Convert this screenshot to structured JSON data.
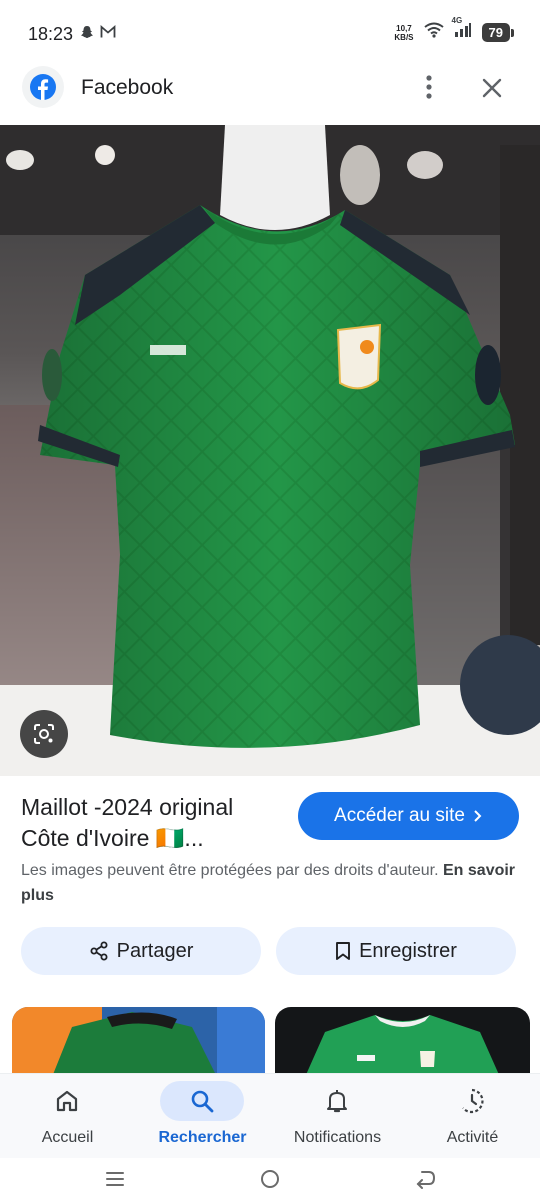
{
  "status": {
    "time": "18:23",
    "net_speed_value": "10,7",
    "net_speed_unit": "KB/S",
    "network": "4G",
    "battery": "79"
  },
  "header": {
    "title": "Facebook"
  },
  "result": {
    "title_line1": "Maillot -2024 original",
    "title_line2": "Côte d'Ivoire 🇨🇮...",
    "visit_label": "Accéder au site",
    "copyright_text": "Les images peuvent être protégées par des droits d'auteur.",
    "learn_more": "En savoir plus"
  },
  "actions": {
    "share_label": "Partager",
    "save_label": "Enregistrer"
  },
  "bottom_nav": {
    "items": [
      {
        "label": "Accueil",
        "icon": "home-icon"
      },
      {
        "label": "Rechercher",
        "icon": "search-icon",
        "active": true
      },
      {
        "label": "Notifications",
        "icon": "bell-icon"
      },
      {
        "label": "Activité",
        "icon": "history-icon"
      }
    ]
  },
  "colors": {
    "accent": "#1a73e8",
    "active_nav": "#1a67d2",
    "jersey_green": "#1f8a3f"
  }
}
